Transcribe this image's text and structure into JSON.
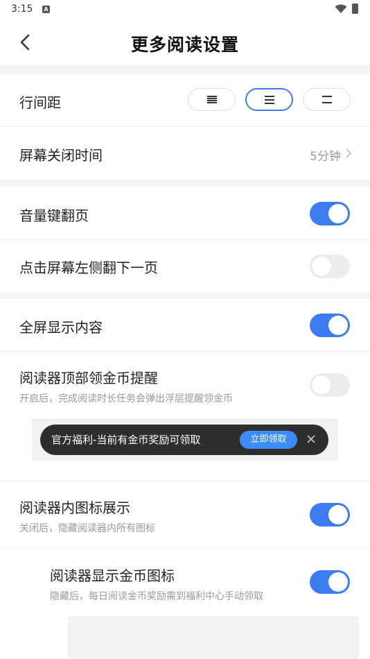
{
  "status": {
    "time": "3:15",
    "notif_letter": "A"
  },
  "header": {
    "title": "更多阅读设置"
  },
  "line_spacing": {
    "label": "行间距",
    "options": [
      "wide",
      "medium",
      "narrow"
    ],
    "selected": 1
  },
  "screen_off": {
    "label": "屏幕关闭时间",
    "value": "5分钟"
  },
  "volume_page": {
    "label": "音量键翻页",
    "on": true
  },
  "tap_left_page": {
    "label": "点击屏幕左侧翻下一页",
    "on": false
  },
  "fullscreen": {
    "label": "全屏显示内容",
    "on": true
  },
  "coin_reminder": {
    "label": "阅读器顶部领金币提醒",
    "sub": "开启后，完成阅读时长任务会弹出浮层提醒领金币",
    "on": false,
    "banner": {
      "text": "官方福利-当前有金币奖励可领取",
      "button": "立即领取"
    }
  },
  "icon_display": {
    "label": "阅读器内图标展示",
    "sub": "关闭后，隐藏阅读器内所有图标",
    "on": true
  },
  "coin_icon": {
    "label": "阅读器显示金币图标",
    "sub": "隐藏后，每日阅读金币奖励需到福利中心手动领取",
    "on": true
  },
  "colors": {
    "accent": "#3b7cf0",
    "toggle_off": "#ececec",
    "banner_bg": "#2e2e2e",
    "banner_button": "#3b8cf7"
  },
  "icons": [
    "back-arrow-icon",
    "wifi-icon",
    "battery-icon",
    "chevron-right-icon",
    "close-icon"
  ]
}
